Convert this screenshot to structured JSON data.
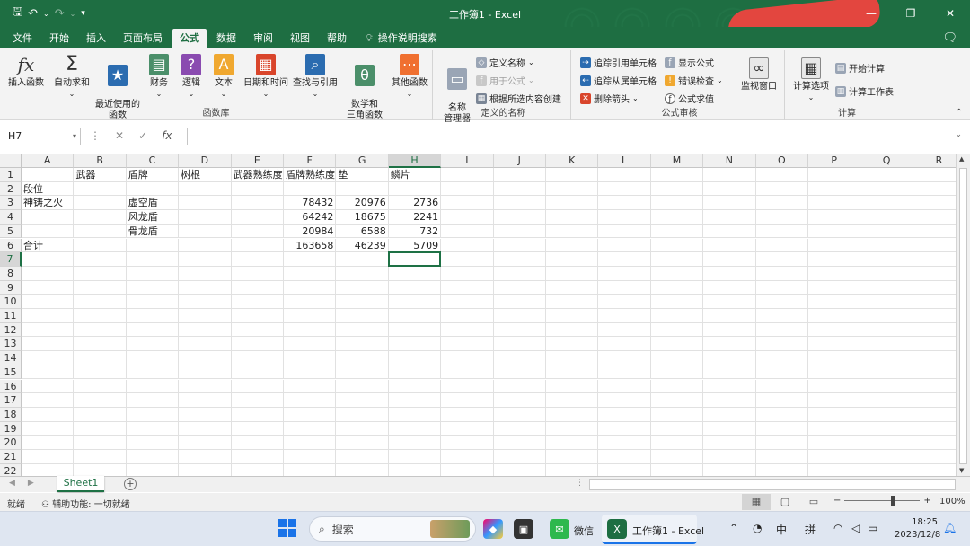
{
  "titlebar": {
    "title": "工作簿1  -  Excel",
    "qat": [
      "save-icon",
      "undo-icon",
      "redo-icon",
      "customize-icon"
    ],
    "window_controls": [
      "minimize",
      "restore",
      "close"
    ]
  },
  "tabs": [
    "文件",
    "开始",
    "插入",
    "页面布局",
    "公式",
    "数据",
    "审阅",
    "视图",
    "帮助"
  ],
  "active_tab": "公式",
  "tell_me": "操作说明搜索",
  "ribbon": {
    "function_library": {
      "label": "函数库",
      "insert_function": "插入函数",
      "autosum": "自动求和",
      "recent": "最近使用的\n函数",
      "financial": "财务",
      "logical": "逻辑",
      "text": "文本",
      "datetime": "日期和时间",
      "lookup": "查找与引用",
      "math": "数学和\n三角函数",
      "more": "其他函数"
    },
    "defined_names": {
      "label": "定义的名称",
      "name_manager": "名称\n管理器",
      "define_name": "定义名称",
      "use_in_formula": "用于公式",
      "create_from_selection": "根据所选内容创建"
    },
    "formula_auditing": {
      "label": "公式审核",
      "trace_precedents": "追踪引用单元格",
      "trace_dependents": "追踪从属单元格",
      "remove_arrows": "删除箭头",
      "show_formulas": "显示公式",
      "error_checking": "错误检查",
      "evaluate_formula": "公式求值",
      "watch_window": "监视窗口"
    },
    "calculation": {
      "label": "计算",
      "calc_options": "计算选项",
      "calc_now": "开始计算",
      "calc_sheet": "计算工作表"
    }
  },
  "formula_bar": {
    "name_box": "H7",
    "formula": ""
  },
  "grid": {
    "columns": [
      "A",
      "B",
      "C",
      "D",
      "E",
      "F",
      "G",
      "H",
      "I",
      "J",
      "K",
      "L",
      "M",
      "N",
      "O",
      "P",
      "Q",
      "R"
    ],
    "rows": [
      "1",
      "2",
      "3",
      "4",
      "5",
      "6",
      "7",
      "8",
      "9",
      "10",
      "11",
      "12",
      "13",
      "14",
      "15",
      "16",
      "17",
      "18",
      "19",
      "20",
      "21",
      "22"
    ],
    "selected_cell": "H7",
    "cells": [
      {
        "ref": "B1",
        "value": "武器",
        "num": false
      },
      {
        "ref": "C1",
        "value": "盾牌",
        "num": false
      },
      {
        "ref": "D1",
        "value": "树根",
        "num": false
      },
      {
        "ref": "E1",
        "value": "武器熟练度",
        "num": false
      },
      {
        "ref": "F1",
        "value": "盾牌熟练度",
        "num": false
      },
      {
        "ref": "G1",
        "value": "垫",
        "num": false
      },
      {
        "ref": "H1",
        "value": "鳞片",
        "num": false
      },
      {
        "ref": "A2",
        "value": "段位",
        "num": false
      },
      {
        "ref": "A3",
        "value": "神铸之火",
        "num": false
      },
      {
        "ref": "C3",
        "value": "虚空盾",
        "num": false
      },
      {
        "ref": "F3",
        "value": "78432",
        "num": true
      },
      {
        "ref": "G3",
        "value": "20976",
        "num": true
      },
      {
        "ref": "H3",
        "value": "2736",
        "num": true
      },
      {
        "ref": "C4",
        "value": "风龙盾",
        "num": false
      },
      {
        "ref": "F4",
        "value": "64242",
        "num": true
      },
      {
        "ref": "G4",
        "value": "18675",
        "num": true
      },
      {
        "ref": "H4",
        "value": "2241",
        "num": true
      },
      {
        "ref": "C5",
        "value": "骨龙盾",
        "num": false
      },
      {
        "ref": "F5",
        "value": "20984",
        "num": true
      },
      {
        "ref": "G5",
        "value": "6588",
        "num": true
      },
      {
        "ref": "H5",
        "value": "732",
        "num": true
      },
      {
        "ref": "A6",
        "value": "合计",
        "num": false
      },
      {
        "ref": "F6",
        "value": "163658",
        "num": true
      },
      {
        "ref": "G6",
        "value": "46239",
        "num": true
      },
      {
        "ref": "H6",
        "value": "5709",
        "num": true
      }
    ]
  },
  "sheet_tabs": [
    "Sheet1"
  ],
  "status": {
    "ready": "就绪",
    "accessibility": "辅助功能: 一切就绪",
    "zoom": "100%"
  },
  "taskbar": {
    "search_placeholder": "搜索",
    "wechat_label": "微信",
    "excel_label": "工作簿1 - Excel",
    "ime1": "中",
    "ime2": "拼",
    "time": "18:25",
    "date": "2023/12/8"
  },
  "colors": {
    "excel_green": "#1e6e42",
    "selection_green": "#1e7145",
    "accent_blue": "#1a73e8"
  }
}
